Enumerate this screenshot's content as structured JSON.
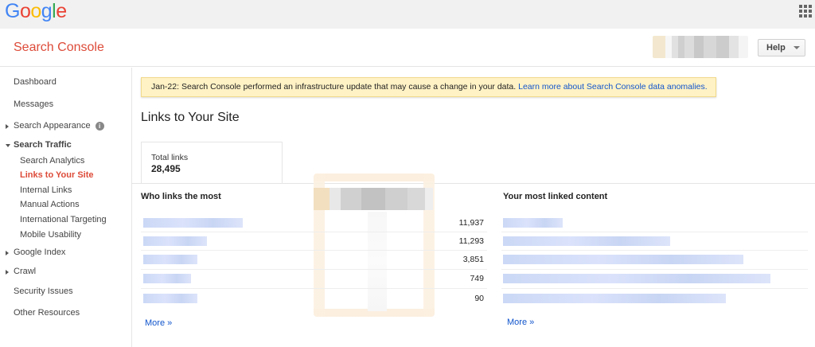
{
  "google_logo": [
    "G",
    "o",
    "o",
    "g",
    "l",
    "e"
  ],
  "colors": {
    "logo": [
      "#4285f4",
      "#ea4335",
      "#fbbc05",
      "#4285f4",
      "#34a853",
      "#ea4335"
    ],
    "brand_red": "#dd4b39",
    "link_blue": "#1155cc",
    "notice_bg": "#fff2c5"
  },
  "header": {
    "app_title": "Search Console",
    "help_label": "Help"
  },
  "sidebar": {
    "items": [
      {
        "label": "Dashboard"
      },
      {
        "label": "Messages"
      },
      {
        "label": "Search Appearance"
      },
      {
        "label": "Search Traffic"
      },
      {
        "label": "Search Analytics"
      },
      {
        "label": "Links to Your Site"
      },
      {
        "label": "Internal Links"
      },
      {
        "label": "Manual Actions"
      },
      {
        "label": "International Targeting"
      },
      {
        "label": "Mobile Usability"
      },
      {
        "label": "Google Index"
      },
      {
        "label": "Crawl"
      },
      {
        "label": "Security Issues"
      },
      {
        "label": "Other Resources"
      }
    ],
    "info_glyph": "i"
  },
  "notice": {
    "text": "Jan-22: Search Console performed an infrastructure update that may cause a change in your data. ",
    "link": "Learn more about Search Console data anomalies."
  },
  "main": {
    "title": "Links to Your Site",
    "total_links_label": "Total links",
    "total_links_value": "28,495",
    "who_links_heading": "Who links the most",
    "most_linked_heading": "Your most linked content",
    "who_links_counts": [
      "11,937",
      "11,293",
      "3,851",
      "749",
      "90"
    ],
    "more_label": "More »",
    "more_label_right": "More »"
  }
}
